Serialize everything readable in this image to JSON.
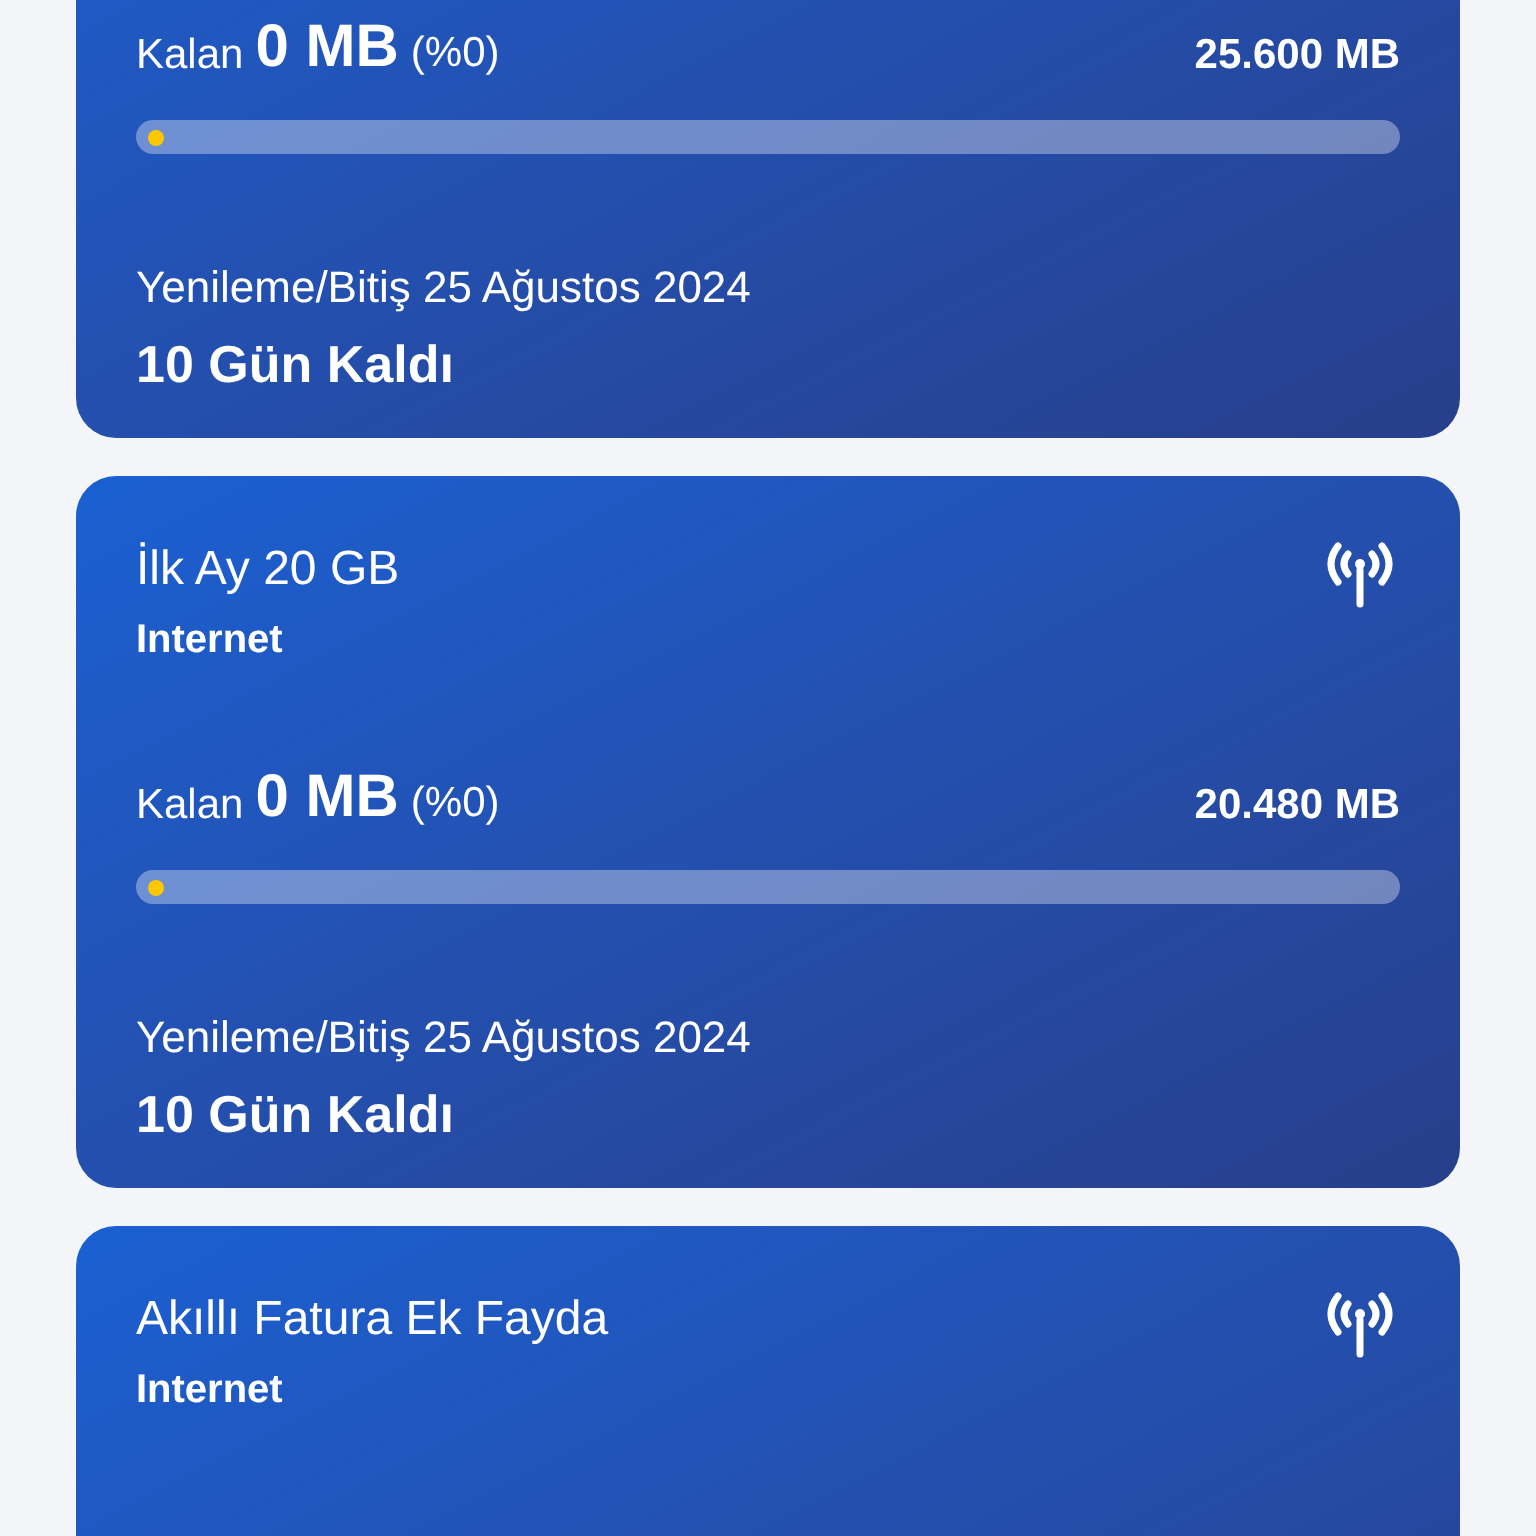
{
  "packages": [
    {
      "remaining_label": "Kalan",
      "remaining_value": "0 MB",
      "remaining_percent": "(%0)",
      "total": "25.600 MB",
      "level": 0,
      "renewal": "Yenileme/Bitiş 25 Ağustos 2024",
      "days_left": "10 Gün Kaldı"
    },
    {
      "title": "İlk Ay 20 GB",
      "category": "Internet",
      "remaining_label": "Kalan",
      "remaining_value": "0 MB",
      "remaining_percent": "(%0)",
      "total": "20.480 MB",
      "level": 0,
      "renewal": "Yenileme/Bitiş 25 Ağustos 2024",
      "days_left": "10 Gün Kaldı"
    },
    {
      "title": "Akıllı Fatura Ek Fayda",
      "category": "Internet"
    }
  ]
}
